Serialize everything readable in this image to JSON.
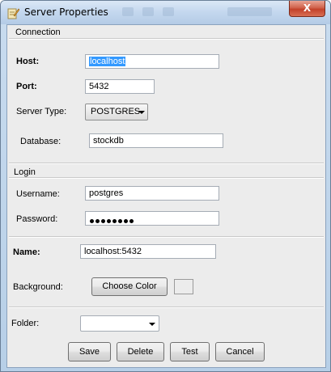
{
  "window": {
    "title": "Server Properties",
    "close_glyph": "X"
  },
  "connection": {
    "group_label": "Connection",
    "host": {
      "label": "Host:",
      "value": "localhost"
    },
    "port": {
      "label": "Port:",
      "value": "5432"
    },
    "server_type": {
      "label": "Server Type:",
      "value": "POSTGRES"
    },
    "database": {
      "label": "Database:",
      "value": "stockdb"
    }
  },
  "login": {
    "group_label": "Login",
    "username": {
      "label": "Username:",
      "value": "postgres"
    },
    "password": {
      "label": "Password:",
      "masked_length": 8
    }
  },
  "name": {
    "label": "Name:",
    "value": "localhost:5432"
  },
  "background": {
    "label": "Background:",
    "button_label": "Choose Color"
  },
  "folder": {
    "label": "Folder:",
    "value": ""
  },
  "buttons": {
    "save": "Save",
    "delete": "Delete",
    "test": "Test",
    "cancel": "Cancel"
  },
  "icons": {
    "title": "pencil-icon",
    "caret": "chevron-down-icon"
  }
}
